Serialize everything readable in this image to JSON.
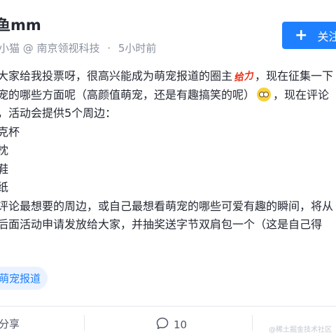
{
  "header": {
    "author_name": "鱼mm",
    "author_role": "小猫 @ 南京领视科技",
    "separator": "·",
    "time_ago": "5小时前",
    "follow_label": "关注",
    "follow_icon": "plus-icon"
  },
  "post": {
    "line1_before": "大家给我投票呀，很高兴能成为萌宠报道的圈主",
    "line1_emoji_text": "给力",
    "line1_after": "，现在征集一下",
    "line2_before": "宠的哪些方面呢（高颜值萌宠，还是有趣搞笑的呢）",
    "line2_emoji": "thinking-face-icon",
    "line2_after": "，现在评论",
    "line3": "，活动会提供5个周边：",
    "line4": "克杯",
    "line5": "枕",
    "line6": "鞋",
    "line7": "纸",
    "line8": "评论最想要的周边，或自己最想看萌宠的哪些可爱有趣的瞬间，将从",
    "line9": "后面活动申请发放给大家，并抽奖送字节双肩包一个（这是自己得"
  },
  "tag": {
    "label": "萌宠报道"
  },
  "actions": {
    "share_label": "分享",
    "share_icon": "share-icon",
    "comment_count": "10",
    "comment_icon": "comment-icon"
  },
  "watermark": "@稀土掘金技术社区"
}
